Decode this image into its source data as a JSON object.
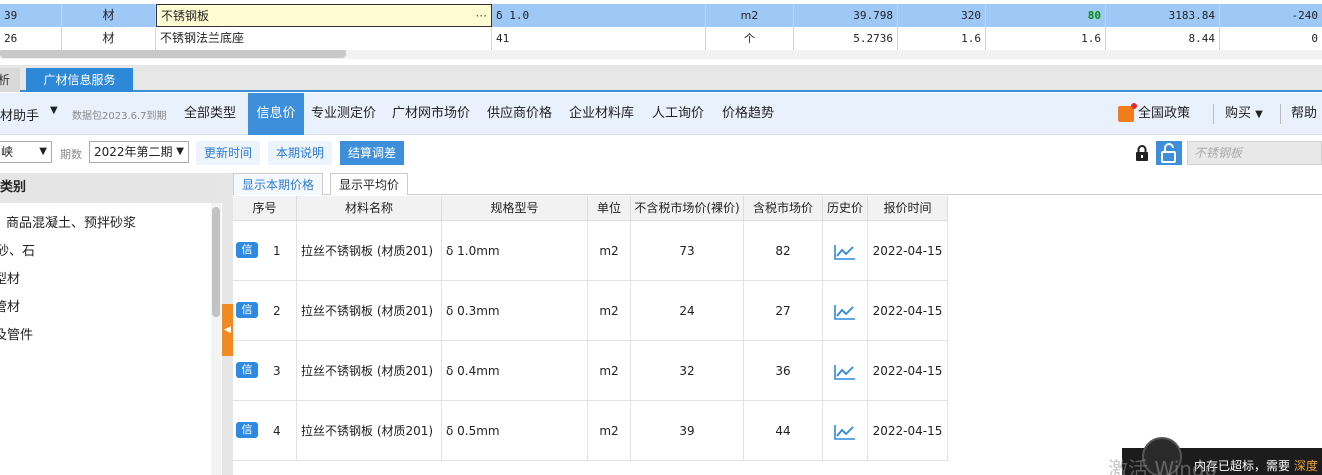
{
  "grid": {
    "rows": [
      {
        "no": "39",
        "type": "材",
        "name": "不锈钢板",
        "name_suffix": "···",
        "spec": "δ 1.0",
        "unit": "m2",
        "qty": "39.798",
        "p1": "320",
        "p2": "80",
        "amount": "3183.84",
        "last": "-240"
      },
      {
        "no": "26",
        "type": "材",
        "name": "不锈钢法兰底座",
        "name_suffix": "",
        "spec": "41",
        "unit": "个",
        "qty": "5.2736",
        "p1": "1.6",
        "p2": "1.6",
        "amount": "8.44",
        "last": "0"
      }
    ]
  },
  "tabs": {
    "prev": "析",
    "active": "广材信息服务"
  },
  "catbar": {
    "assistant": "材助手",
    "data_pack": "数据包2023.6.7到期",
    "items": [
      "全部类型",
      "信息价",
      "专业测定价",
      "广材网市场价",
      "供应商价格",
      "企业材料库",
      "人工询价",
      "价格趋势"
    ],
    "active_index": 1,
    "policy": "全国政策",
    "buy": "购买",
    "help": "帮助"
  },
  "filter": {
    "region": "峡",
    "period_label": "期数",
    "period": "2022年第二期",
    "update_time": "更新时间",
    "period_note": "本期说明",
    "settle": "结算调差",
    "search_placeholder": "不锈钢板"
  },
  "tree": {
    "header": "类别",
    "items": [
      "商品混凝土、预拌砂浆",
      "砂、石",
      "型材",
      "管材",
      "及管件"
    ]
  },
  "subtabs": {
    "current": "显示本期价格",
    "average": "显示平均价"
  },
  "table": {
    "headers": [
      "序号",
      "材料名称",
      "规格型号",
      "单位",
      "不含税市场价(裸价)",
      "含税市场价",
      "历史价",
      "报价时间"
    ],
    "badge": "信",
    "rows": [
      {
        "no": "1",
        "name": "拉丝不锈钢板 (材质201)",
        "spec": "δ 1.0mm",
        "unit": "m2",
        "p1": "73",
        "p2": "82",
        "date": "2022-04-15"
      },
      {
        "no": "2",
        "name": "拉丝不锈钢板 (材质201)",
        "spec": "δ 0.3mm",
        "unit": "m2",
        "p1": "24",
        "p2": "27",
        "date": "2022-04-15"
      },
      {
        "no": "3",
        "name": "拉丝不锈钢板 (材质201)",
        "spec": "δ 0.4mm",
        "unit": "m2",
        "p1": "32",
        "p2": "36",
        "date": "2022-04-15"
      },
      {
        "no": "4",
        "name": "拉丝不锈钢板 (材质201)",
        "spec": "δ 0.5mm",
        "unit": "m2",
        "p1": "39",
        "p2": "44",
        "date": "2022-04-15"
      }
    ]
  },
  "overlay": {
    "watermark": "激活 Windo",
    "notify_text": "内存已超标，需要",
    "notify_highlight": "深度"
  },
  "colors": {
    "accent": "#3d8fdb",
    "selected_row": "#9ec9f7",
    "orange": "#f08a24",
    "green": "#0a8a0a"
  }
}
